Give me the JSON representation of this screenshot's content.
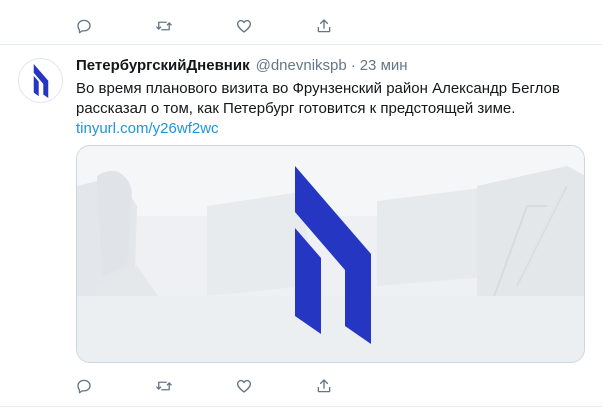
{
  "tweet": {
    "display_name": "ПетербургскийДневник",
    "handle": "@dnevnikspb",
    "separator": "·",
    "time": "23 мин",
    "text": "Во время планового визита во Фрунзенский район Александр Беглов рассказал о том, как Петербург готовится к предстоящей зиме.",
    "link": "tinyurl.com/y26wf2wc"
  },
  "icons": {
    "reply": "reply-icon",
    "retweet": "retweet-icon",
    "like": "like-icon",
    "share": "share-icon"
  },
  "colors": {
    "brand_blue": "#2536c3",
    "link": "#1b95e0",
    "secondary_text": "#657786",
    "icon_gray": "#657786"
  }
}
